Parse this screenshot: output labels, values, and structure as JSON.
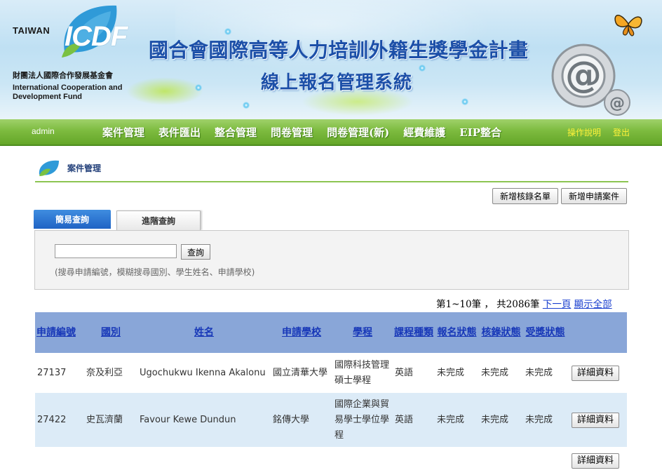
{
  "brand": {
    "taiwan": "TAIWAN",
    "icdf": "ICDF",
    "org_cn": "財團法人國際合作發展基金會",
    "org_en_line1": "International Cooperation and",
    "org_en_line2": "Development Fund",
    "title_line1": "國合會國際高等人力培訓外籍生獎學金計畫",
    "title_line2": "線上報名管理系統",
    "leaf_color": "#2f9ad8",
    "leaf_green": "#7ac142"
  },
  "nav": {
    "user": "admin",
    "items": [
      "案件管理",
      "表件匯出",
      "整合管理",
      "問卷管理",
      "問卷管理(新)",
      "經費維護",
      "EIP整合"
    ],
    "help": "操作說明",
    "logout": "登出",
    "bar_color": "#7dbb3f",
    "link_color": "#fff23a"
  },
  "section": {
    "title": "案件管理"
  },
  "actions": {
    "add_review_list": "新增核錄名單",
    "add_application": "新增申請案件"
  },
  "tabs": {
    "simple": "簡易查詢",
    "advanced": "進階查詢"
  },
  "search": {
    "value": "",
    "button": "查詢",
    "hint": "(搜尋申請編號，模糊搜尋國別、學生姓名、申請學校)"
  },
  "pager": {
    "summary": "第1~10筆 ， 共2086筆",
    "next": "下一頁",
    "show_all": "顯示全部"
  },
  "table": {
    "headers": [
      "申請編號",
      "國別",
      "姓名",
      "申請學校",
      "學程",
      "課程種類",
      "報名狀態",
      "核錄狀態",
      "受獎狀態"
    ],
    "detail_label": "詳細資料",
    "rows": [
      {
        "id": "27137",
        "country": "奈及利亞",
        "name": "Ugochukwu Ikenna Akalonu",
        "school": "國立清華大學",
        "program": "國際科技管理碩士學程",
        "course": "英語",
        "apply": "未完成",
        "review": "未完成",
        "award": "未完成"
      },
      {
        "id": "27422",
        "country": "史瓦濟蘭",
        "name": "Favour Kewe Dundun",
        "school": "銘傳大學",
        "program": "國際企業與貿易學士學位學程",
        "course": "英語",
        "apply": "未完成",
        "review": "未完成",
        "award": "未完成"
      }
    ]
  }
}
